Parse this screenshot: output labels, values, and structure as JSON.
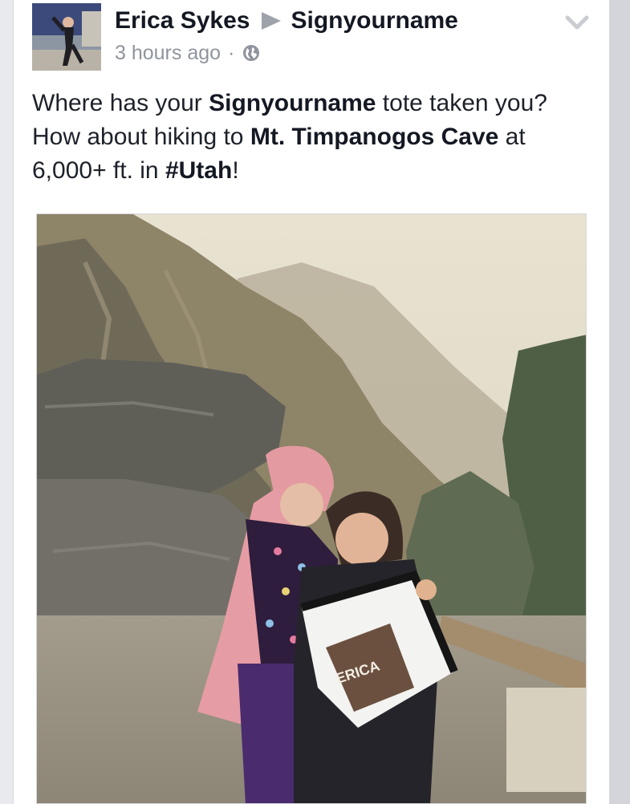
{
  "post": {
    "author": "Erica Sykes",
    "page": "Signyourname",
    "timestamp": "3 hours ago",
    "separator": "·",
    "privacy_icon": "globe-icon",
    "menu_icon": "chevron-down-icon",
    "text": [
      {
        "t": "Where has your ",
        "b": false
      },
      {
        "t": "Signyourname",
        "b": true
      },
      {
        "t": " tote taken you? How about hiking to ",
        "b": false
      },
      {
        "t": "Mt. Timpanogos Cave",
        "b": true
      },
      {
        "t": " at 6,000+ ft. in ",
        "b": false
      },
      {
        "t": "#Utah",
        "b": true
      },
      {
        "t": "!",
        "b": false
      }
    ],
    "photo": {
      "tote_text": "ERICA"
    }
  },
  "colors": {
    "card": "#ffffff",
    "background": "#e9eaed",
    "name": "#141823",
    "meta": "#8f949c"
  }
}
